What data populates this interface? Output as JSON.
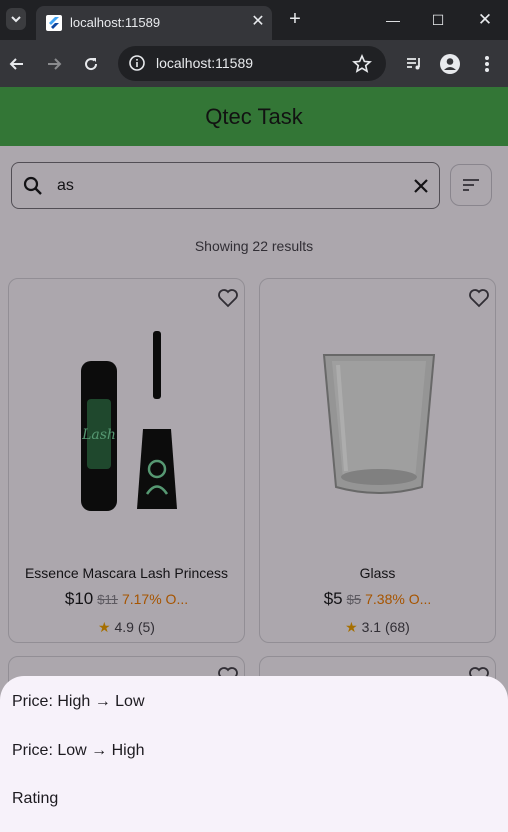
{
  "browser": {
    "tab_title": "localhost:11589",
    "url": "localhost:11589"
  },
  "app": {
    "title": "Qtec Task",
    "search_value": "as",
    "results_text": "Showing 22 results"
  },
  "products": [
    {
      "title": "Essence Mascara Lash Princess",
      "price": "$10",
      "old_price": "$11",
      "discount": "7.17% O...",
      "rating": "4.9 (5)"
    },
    {
      "title": "Glass",
      "price": "$5",
      "old_price": "$5",
      "discount": "7.38% O...",
      "rating": "3.1 (68)"
    }
  ],
  "sort_sheet": {
    "options": [
      "Price: High → Low",
      "Price: Low → High",
      "Rating"
    ]
  },
  "colors": {
    "app_bar": "#4caf50",
    "discount": "#f57c00",
    "star": "#f5a400"
  }
}
